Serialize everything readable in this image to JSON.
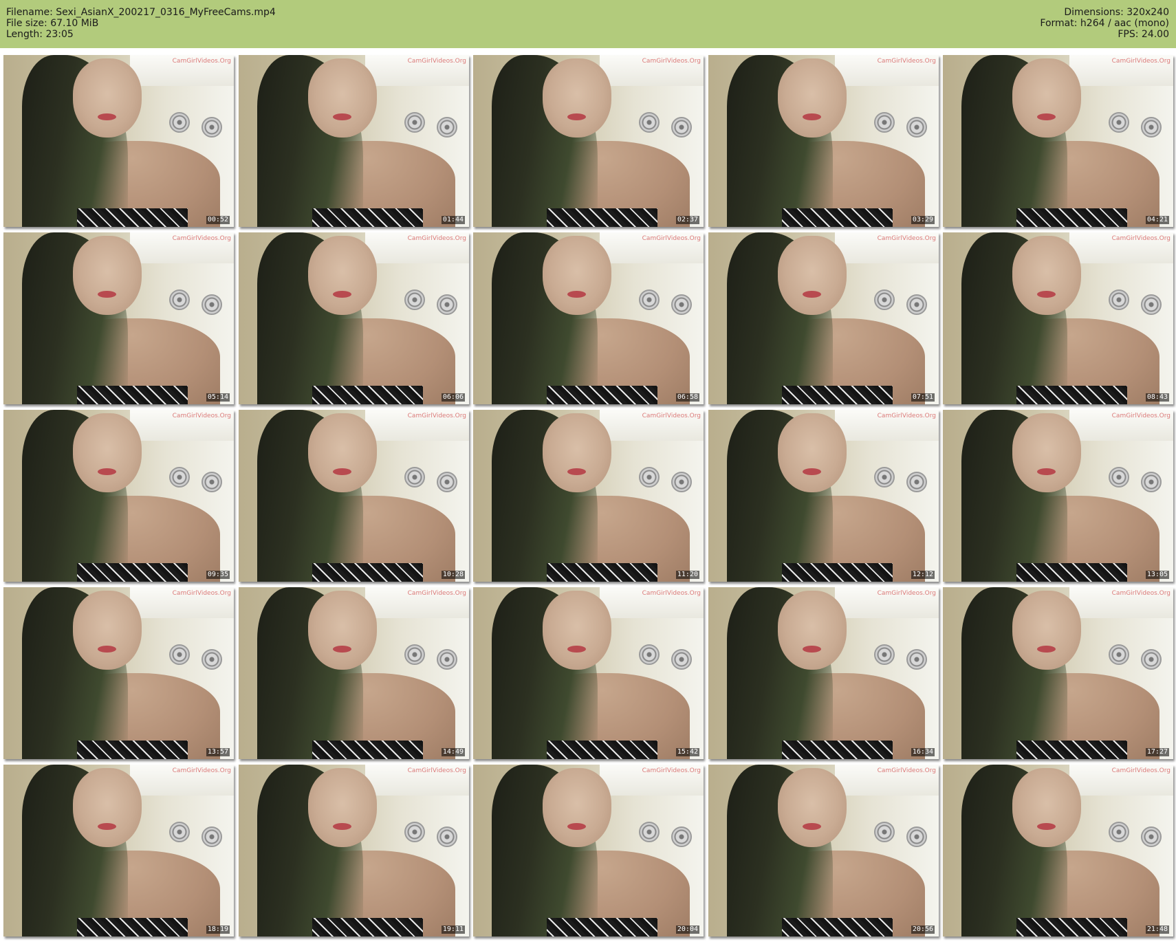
{
  "header": {
    "filename_line": "Filename: Sexi_AsianX_200217_0316_MyFreeCams.mp4",
    "filesize_line": "File size: 67.10 MiB",
    "length_line": "Length: 23:05",
    "dimensions_line": "Dimensions: 320x240",
    "format_line": "Format: h264 / aac (mono)",
    "fps_line": "FPS: 24.00"
  },
  "colors": {
    "header_bg": "#b2cb7c",
    "page_bg": "#ffffff"
  },
  "watermark": "CamGirlVideos.Org",
  "thumbnails": [
    {
      "time": "00:52"
    },
    {
      "time": "01:44"
    },
    {
      "time": "02:37"
    },
    {
      "time": "03:29"
    },
    {
      "time": "04:21"
    },
    {
      "time": "05:14"
    },
    {
      "time": "06:06"
    },
    {
      "time": "06:58"
    },
    {
      "time": "07:51"
    },
    {
      "time": "08:43"
    },
    {
      "time": "09:35"
    },
    {
      "time": "10:28"
    },
    {
      "time": "11:20"
    },
    {
      "time": "12:12"
    },
    {
      "time": "13:05"
    },
    {
      "time": "13:57"
    },
    {
      "time": "14:49"
    },
    {
      "time": "15:42"
    },
    {
      "time": "16:34"
    },
    {
      "time": "17:27"
    },
    {
      "time": "18:19"
    },
    {
      "time": "19:11"
    },
    {
      "time": "20:04"
    },
    {
      "time": "20:56"
    },
    {
      "time": "21:48"
    }
  ]
}
